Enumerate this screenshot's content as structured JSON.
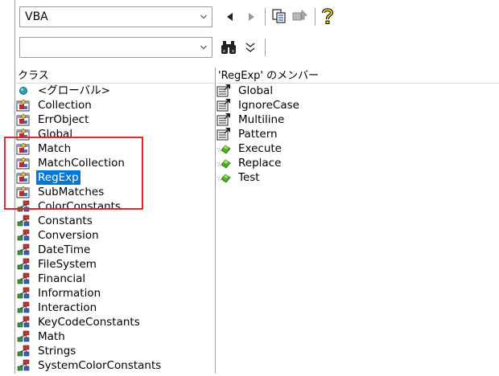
{
  "toolbar": {
    "library_value": "VBA",
    "search_value": ""
  },
  "classes": {
    "header": "クラス",
    "items": [
      {
        "label": "<グローバル>",
        "icon": "globe-icon"
      },
      {
        "label": "Collection",
        "icon": "class-icon"
      },
      {
        "label": "ErrObject",
        "icon": "class-icon"
      },
      {
        "label": "Global",
        "icon": "class-icon"
      },
      {
        "label": "Match",
        "icon": "class-icon"
      },
      {
        "label": "MatchCollection",
        "icon": "class-icon"
      },
      {
        "label": "RegExp",
        "icon": "class-icon"
      },
      {
        "label": "SubMatches",
        "icon": "class-icon"
      },
      {
        "label": "ColorConstants",
        "icon": "module-icon"
      },
      {
        "label": "Constants",
        "icon": "module-icon"
      },
      {
        "label": "Conversion",
        "icon": "module-icon"
      },
      {
        "label": "DateTime",
        "icon": "module-icon"
      },
      {
        "label": "FileSystem",
        "icon": "module-icon"
      },
      {
        "label": "Financial",
        "icon": "module-icon"
      },
      {
        "label": "Information",
        "icon": "module-icon"
      },
      {
        "label": "Interaction",
        "icon": "module-icon"
      },
      {
        "label": "KeyCodeConstants",
        "icon": "module-icon"
      },
      {
        "label": "Math",
        "icon": "module-icon"
      },
      {
        "label": "Strings",
        "icon": "module-icon"
      },
      {
        "label": "SystemColorConstants",
        "icon": "module-icon"
      }
    ],
    "selected": "RegExp"
  },
  "members": {
    "header": "'RegExp' のメンバー",
    "items": [
      {
        "label": "Global",
        "icon": "property-icon"
      },
      {
        "label": "IgnoreCase",
        "icon": "property-icon"
      },
      {
        "label": "Multiline",
        "icon": "property-icon"
      },
      {
        "label": "Pattern",
        "icon": "property-icon"
      },
      {
        "label": "Execute",
        "icon": "method-icon"
      },
      {
        "label": "Replace",
        "icon": "method-icon"
      },
      {
        "label": "Test",
        "icon": "method-icon"
      }
    ]
  },
  "highlight_color": "#e8232b",
  "selection_color": "#0078d7"
}
